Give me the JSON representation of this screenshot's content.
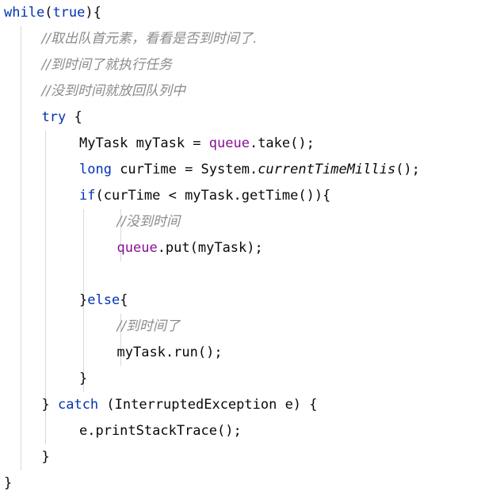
{
  "editor": {
    "language": "Java",
    "theme": "IntelliJ Light",
    "colors": {
      "background": "#ffffff",
      "keyword": "#0033B3",
      "field": "#871094",
      "comment": "#8C8C8C",
      "text": "#080808",
      "indent_guide": "#d8d8d8"
    },
    "indent_guides_x": [
      26,
      57,
      105,
      152
    ]
  },
  "code": {
    "lines": [
      {
        "indent": 0,
        "tokens": [
          {
            "t": "while",
            "c": "kw"
          },
          {
            "t": "(",
            "c": "plain"
          },
          {
            "t": "true",
            "c": "kw"
          },
          {
            "t": "){",
            "c": "plain"
          }
        ]
      },
      {
        "indent": 1,
        "tokens": [
          {
            "t": "//取出队首元素，看看是否到时间了.",
            "c": "cmt"
          }
        ]
      },
      {
        "indent": 1,
        "tokens": [
          {
            "t": "//到时间了就执行任务",
            "c": "cmt"
          }
        ]
      },
      {
        "indent": 1,
        "tokens": [
          {
            "t": "//没到时间就放回队列中",
            "c": "cmt"
          }
        ]
      },
      {
        "indent": 1,
        "tokens": [
          {
            "t": "try",
            "c": "kw"
          },
          {
            "t": " {",
            "c": "plain"
          }
        ]
      },
      {
        "indent": 2,
        "tokens": [
          {
            "t": "MyTask myTask = ",
            "c": "plain"
          },
          {
            "t": "queue",
            "c": "fld"
          },
          {
            "t": ".take();",
            "c": "plain"
          }
        ]
      },
      {
        "indent": 2,
        "tokens": [
          {
            "t": "long",
            "c": "kw"
          },
          {
            "t": " curTime = System.",
            "c": "plain"
          },
          {
            "t": "currentTimeMillis",
            "c": "stat"
          },
          {
            "t": "();",
            "c": "plain"
          }
        ]
      },
      {
        "indent": 2,
        "tokens": [
          {
            "t": "if",
            "c": "kw"
          },
          {
            "t": "(curTime < myTask.getTime()){",
            "c": "plain"
          }
        ]
      },
      {
        "indent": 3,
        "tokens": [
          {
            "t": "//没到时间",
            "c": "cmt"
          }
        ]
      },
      {
        "indent": 3,
        "tokens": [
          {
            "t": "queue",
            "c": "fld"
          },
          {
            "t": ".put(myTask);",
            "c": "plain"
          }
        ]
      },
      {
        "indent": 0,
        "tokens": []
      },
      {
        "indent": 2,
        "tokens": [
          {
            "t": "}",
            "c": "plain"
          },
          {
            "t": "else",
            "c": "kw"
          },
          {
            "t": "{",
            "c": "plain"
          }
        ]
      },
      {
        "indent": 3,
        "tokens": [
          {
            "t": "//到时间了",
            "c": "cmt"
          }
        ]
      },
      {
        "indent": 3,
        "tokens": [
          {
            "t": "myTask.run();",
            "c": "plain"
          }
        ]
      },
      {
        "indent": 2,
        "tokens": [
          {
            "t": "}",
            "c": "plain"
          }
        ]
      },
      {
        "indent": 1,
        "tokens": [
          {
            "t": "} ",
            "c": "plain"
          },
          {
            "t": "catch",
            "c": "kw"
          },
          {
            "t": " (InterruptedException e) {",
            "c": "plain"
          }
        ]
      },
      {
        "indent": 2,
        "tokens": [
          {
            "t": "e.printStackTrace();",
            "c": "plain"
          }
        ]
      },
      {
        "indent": 1,
        "tokens": [
          {
            "t": "}",
            "c": "plain"
          }
        ]
      },
      {
        "indent": 0,
        "tokens": [
          {
            "t": "}",
            "c": "plain"
          }
        ]
      }
    ]
  }
}
